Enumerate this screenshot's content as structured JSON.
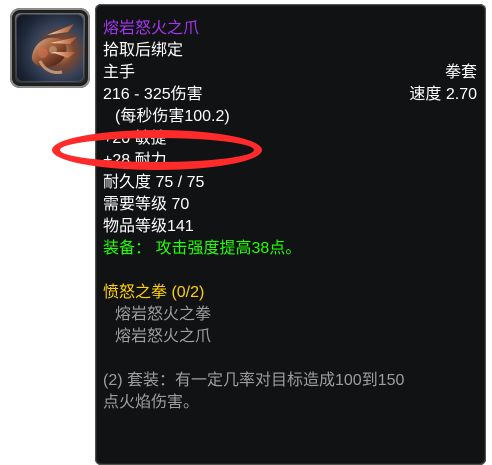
{
  "item": {
    "name": "熔岩怒火之爪",
    "bind": "拾取后绑定",
    "slot": "主手",
    "type": "拳套",
    "damage": "216 - 325伤害",
    "speed": "速度 2.70",
    "dps": "(每秒伤害100.2)",
    "stats": [
      "+20 敏捷",
      "+28 耐力"
    ],
    "durability": "耐久度 75 / 75",
    "required_level": "需要等级 70",
    "item_level": "物品等级141",
    "equip_effect": "装备： 攻击强度提高38点。",
    "set": {
      "title": "愤怒之拳 (0/2)",
      "items": [
        "熔岩怒火之拳",
        "熔岩怒火之爪"
      ],
      "bonus_line_1": "(2) 套装：有一定几率对目标造成100到150",
      "bonus_line_2": "点火焰伤害。"
    }
  }
}
